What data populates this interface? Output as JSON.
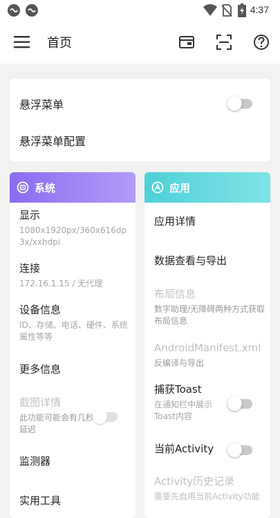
{
  "status_bar": {
    "time": "4:37"
  },
  "app_bar": {
    "title": "首页"
  },
  "floating_menu": {
    "toggle_label": "悬浮菜单",
    "config_label": "悬浮菜单配置",
    "toggle_on": false
  },
  "system": {
    "header": "系统",
    "colors": {
      "header_start": "#8c6cf0",
      "header_end": "#b29bf7"
    },
    "items": [
      {
        "title": "显示",
        "sub": "1080x1920px/360x616dp 3x/xxhdpi"
      },
      {
        "title": "连接",
        "sub": "172.16.1.15 / 无代理"
      },
      {
        "title": "设备信息",
        "sub": "ID、存储、电话、硬件、系统属性等等"
      },
      {
        "title": "更多信息",
        "sub": ""
      },
      {
        "title": "截图详情",
        "sub": "此功能可能会有几秒延迟",
        "toggle_on": false
      },
      {
        "title": "监测器",
        "sub": ""
      },
      {
        "title": "实用工具",
        "sub": ""
      }
    ]
  },
  "apps": {
    "header": "应用",
    "colors": {
      "header_start": "#4fd0d8",
      "header_end": "#7ee3e6"
    },
    "items": [
      {
        "title": "应用详情",
        "sub": ""
      },
      {
        "title": "数据查看与导出",
        "sub": ""
      },
      {
        "title": "布局信息",
        "sub": "数字助理/无障碍两种方式获取布局信息"
      },
      {
        "title": "AndroidManifest.xml",
        "sub": "反编译与导出"
      },
      {
        "title": "捕获Toast",
        "sub": "在通知栏中展示Toast内容",
        "toggle_on": false
      },
      {
        "title": "当前Activity",
        "sub": "",
        "toggle_on": false
      },
      {
        "title": "Activity历史记录",
        "sub": "需要先启用当前Activity功能"
      }
    ]
  }
}
